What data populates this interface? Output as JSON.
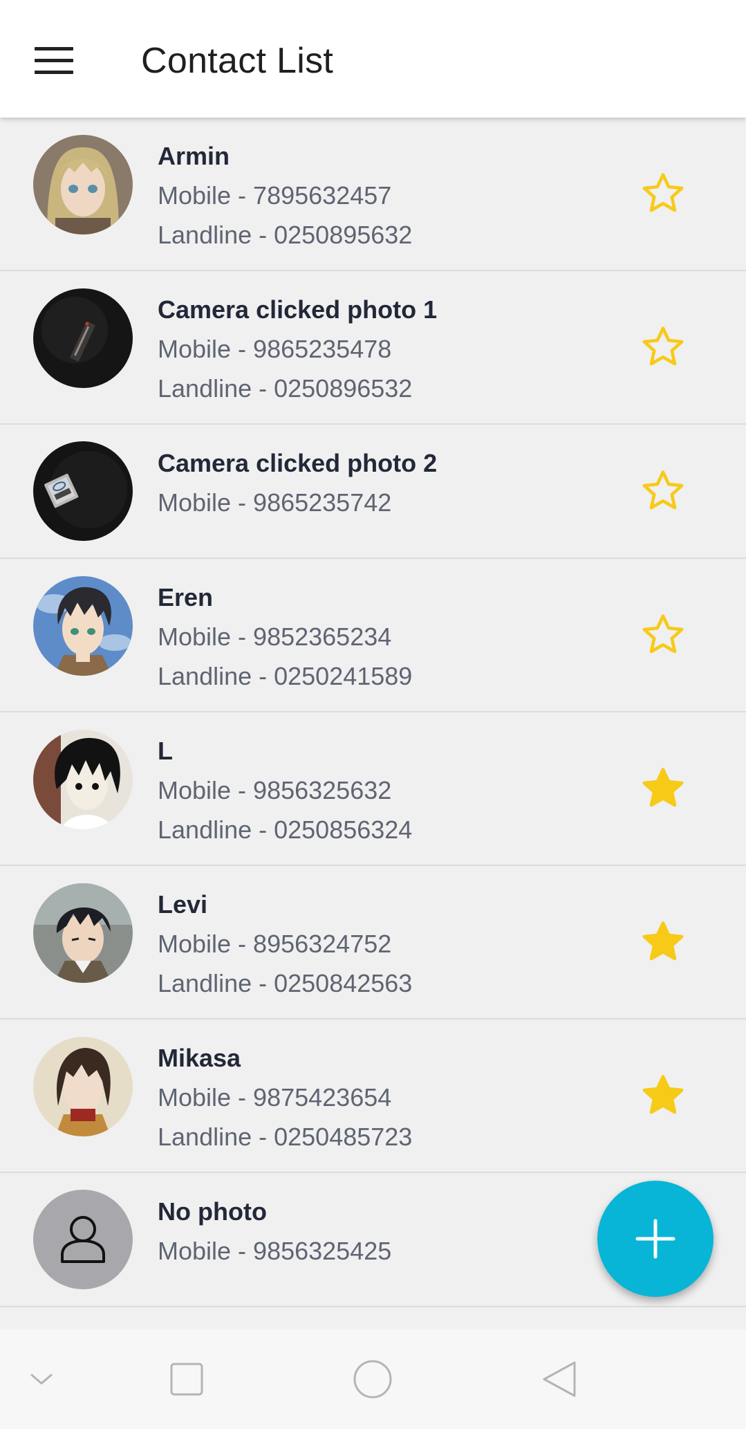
{
  "app_bar": {
    "title": "Contact List",
    "menu_icon": "menu-icon"
  },
  "contacts": [
    {
      "name": "Armin",
      "mobile": "Mobile - 7895632457",
      "landline": "Landline - 0250895632",
      "favorite": false,
      "avatar": "armin-avatar"
    },
    {
      "name": "Camera clicked photo 1",
      "mobile": "Mobile - 9865235478",
      "landline": "Landline - 0250896532",
      "favorite": false,
      "avatar": "laptop-photo-avatar"
    },
    {
      "name": "Camera clicked photo 2",
      "mobile": "Mobile - 9865235742",
      "landline": null,
      "favorite": false,
      "avatar": "laptop-sticker-avatar"
    },
    {
      "name": "Eren",
      "mobile": "Mobile - 9852365234",
      "landline": "Landline - 0250241589",
      "favorite": false,
      "avatar": "eren-avatar"
    },
    {
      "name": "L",
      "mobile": "Mobile - 9856325632",
      "landline": "Landline - 0250856324",
      "favorite": true,
      "avatar": "l-avatar"
    },
    {
      "name": "Levi",
      "mobile": "Mobile - 8956324752",
      "landline": "Landline - 0250842563",
      "favorite": true,
      "avatar": "levi-avatar"
    },
    {
      "name": "Mikasa",
      "mobile": "Mobile - 9875423654",
      "landline": "Landline - 0250485723",
      "favorite": true,
      "avatar": "mikasa-avatar"
    },
    {
      "name": "No photo",
      "mobile": "Mobile - 9856325425",
      "landline": null,
      "favorite": false,
      "avatar": "default-person-avatar"
    }
  ],
  "fab": {
    "icon": "plus-icon"
  },
  "nav_bar": {
    "icons": [
      "chevron-down-icon",
      "square-icon",
      "circle-icon",
      "triangle-back-icon"
    ]
  },
  "colors": {
    "star": "#f7ca18",
    "fab": "#08b5d6",
    "text_primary": "#222838",
    "text_secondary": "#5f6472"
  }
}
